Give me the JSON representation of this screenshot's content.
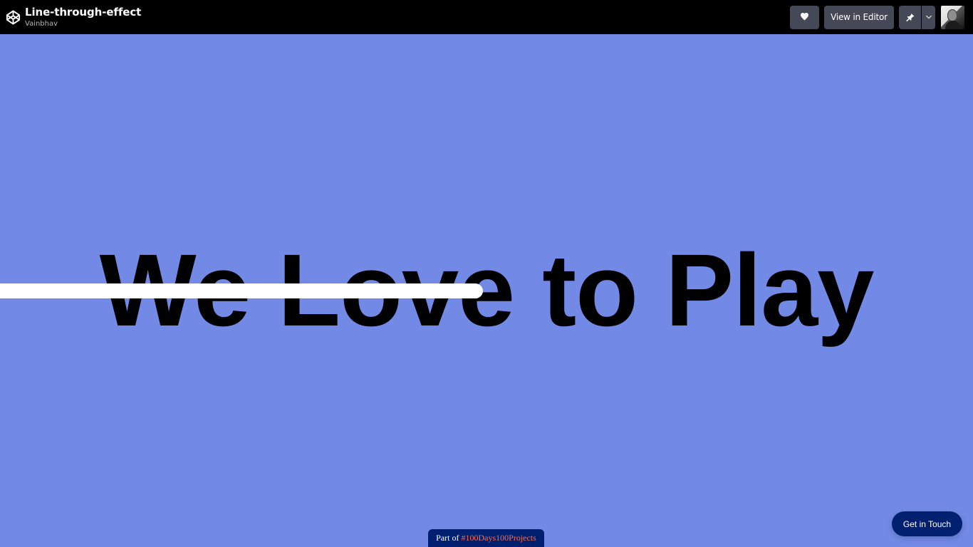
{
  "app": {
    "title": "Line-through-effect",
    "author": "Vainbhav"
  },
  "toolbar": {
    "heart_icon": "heart-icon",
    "view_editor_label": "View in Editor",
    "pin_icon": "pin-icon",
    "dropdown_icon": "chevron-down-icon",
    "avatar_alt": "avatar"
  },
  "main": {
    "headline": "We Love to Play",
    "strike_color": "#ffffff"
  },
  "footer": {
    "prefix": "Part of",
    "link": "#100Days100Projects"
  },
  "contact": {
    "label": "Get in Touch"
  },
  "colors": {
    "background": "#7289e6",
    "topbar": "#000000",
    "button": "#444857",
    "accent": "#001f6f",
    "link": "#ff6b4a"
  }
}
